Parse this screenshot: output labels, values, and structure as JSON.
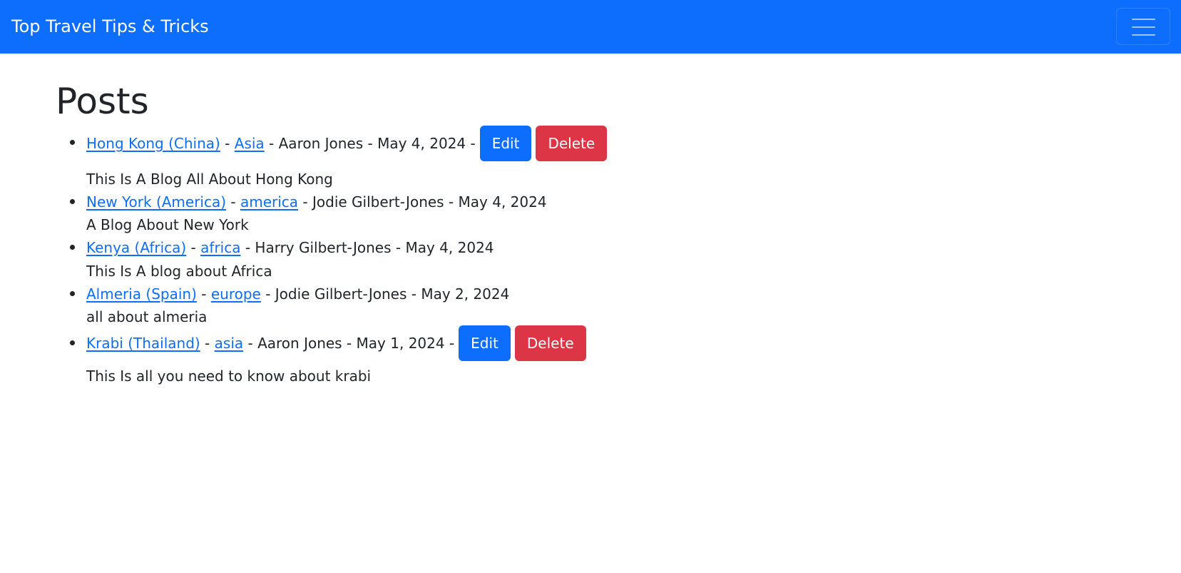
{
  "navbar": {
    "brand": "Top Travel Tips & Tricks",
    "toggler_icon": "hamburger-menu-icon"
  },
  "page": {
    "title": "Posts"
  },
  "colors": {
    "navbar": "#0d6efd",
    "link": "#0d6efd",
    "edit_button": "#0d6efd",
    "delete_button": "#dc3545"
  },
  "posts": [
    {
      "title": "Hong Kong (China)",
      "category": "Asia",
      "author": "Aaron Jones",
      "date": "May 4, 2024",
      "description": "This Is A Blog All About Hong Kong",
      "edit_label": "Edit",
      "delete_label": "Delete"
    },
    {
      "title": "New York (America)",
      "category": "america",
      "author": "Jodie Gilbert-Jones",
      "date": "May 4, 2024",
      "description": "A Blog About New York"
    },
    {
      "title": "Kenya (Africa)",
      "category": "africa",
      "author": "Harry Gilbert-Jones",
      "date": "May 4, 2024",
      "description": "This Is A blog about Africa"
    },
    {
      "title": "Almeria (Spain)",
      "category": "europe",
      "author": "Jodie Gilbert-Jones",
      "date": "May 2, 2024",
      "description": "all about almeria"
    },
    {
      "title": "Krabi (Thailand)",
      "category": "asia",
      "author": "Aaron Jones",
      "date": "May 1, 2024",
      "description": "This Is all you need to know about krabi",
      "edit_label": "Edit",
      "delete_label": "Delete"
    }
  ]
}
